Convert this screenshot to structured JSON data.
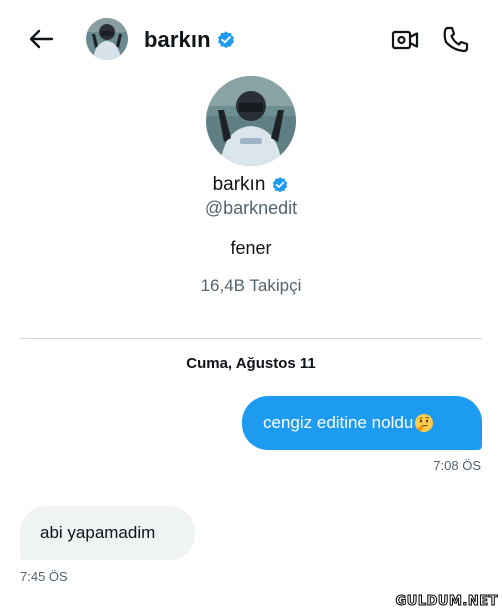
{
  "header": {
    "name": "barkın",
    "verified": true,
    "icons": {
      "back": "arrow-left-icon",
      "video": "video-call-icon",
      "call": "phone-icon",
      "verified": "verified-badge-icon"
    }
  },
  "profile": {
    "name": "barkın",
    "handle": "@barknedit",
    "bio": "fener",
    "followers": "16,4B Takipçi"
  },
  "conversation": {
    "date": "Cuma, Ağustos 11",
    "messages": [
      {
        "direction": "sent",
        "text": "cengiz editine noldu",
        "emoji": "thinking-face",
        "time": "7:08 ÖS"
      },
      {
        "direction": "received",
        "text": "abi yapamadim",
        "time": "7:45 ÖS"
      }
    ]
  },
  "colors": {
    "accent": "#1d9bf0",
    "received_bubble": "#eff3f4",
    "secondary_text": "#536471",
    "divider": "#cfd9de"
  },
  "watermark": "GULDUM.NET"
}
